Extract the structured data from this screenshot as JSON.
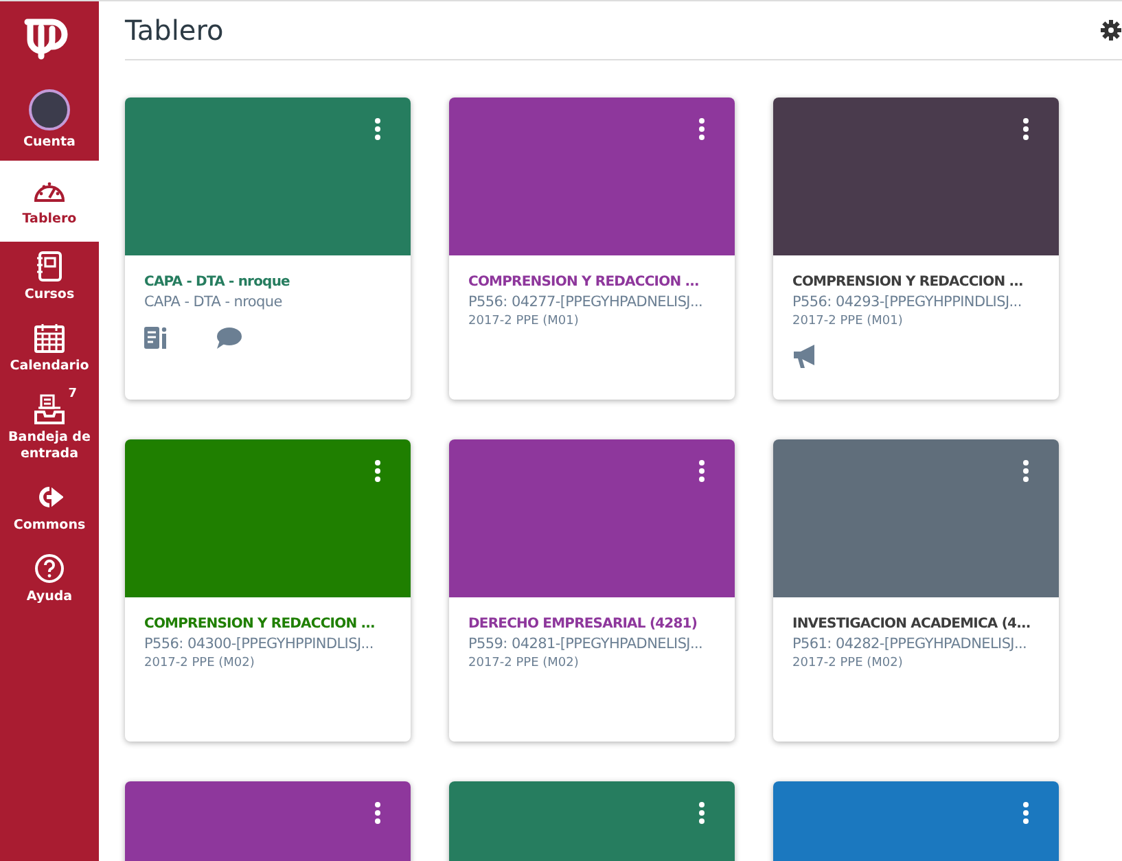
{
  "nav": {
    "items": [
      {
        "kind": "avatar",
        "label": "Cuenta",
        "selected": false
      },
      {
        "kind": "dashboard",
        "label": "Tablero",
        "selected": true
      },
      {
        "kind": "courses",
        "label": "Cursos",
        "selected": false
      },
      {
        "kind": "calendar",
        "label": "Calendario",
        "selected": false
      },
      {
        "kind": "inbox",
        "label": "Bandeja de entrada",
        "selected": false,
        "badge": "7"
      },
      {
        "kind": "commons",
        "label": "Commons",
        "selected": false
      },
      {
        "kind": "help",
        "label": "Ayuda",
        "selected": false
      }
    ]
  },
  "header": {
    "title": "Tablero"
  },
  "cards": [
    {
      "color": "#267d5f",
      "title": "CAPA - DTA - nroque",
      "code": "CAPA - DTA - nroque",
      "icons": [
        {
          "kind": "assignments"
        },
        {
          "kind": "discussions"
        }
      ]
    },
    {
      "color": "#8e379c",
      "title": "COMPRENSION Y REDACCION ...",
      "code": "P556: 04277-[PPEGYHPADNELISJ...",
      "term": "2017-2 PPE (M01)"
    },
    {
      "color": "#4a3b4d",
      "title": "COMPRENSION Y REDACCION ...",
      "code": "P556: 04293-[PPEGYHPPINDLISJ...",
      "term": "2017-2 PPE (M01)",
      "icons": [
        {
          "kind": "announcements"
        }
      ]
    },
    {
      "color": "#1f7f00",
      "title": "COMPRENSION Y REDACCION ...",
      "code": "P556: 04300-[PPEGYHPPINDLISJ...",
      "term": "2017-2 PPE (M02)"
    },
    {
      "color": "#8e379c",
      "title": "DERECHO EMPRESARIAL (4281)",
      "code": "P559: 04281-[PPEGYHPADNELISJ...",
      "term": "2017-2 PPE (M02)"
    },
    {
      "color": "#606e7b",
      "title": "INVESTIGACION ACADEMICA (4...",
      "code": "P561: 04282-[PPEGYHPADNELISJ...",
      "term": "2017-2 PPE (M02)"
    },
    {
      "color": "#8e379c"
    },
    {
      "color": "#267d5f"
    },
    {
      "color": "#1b78bf"
    }
  ]
}
